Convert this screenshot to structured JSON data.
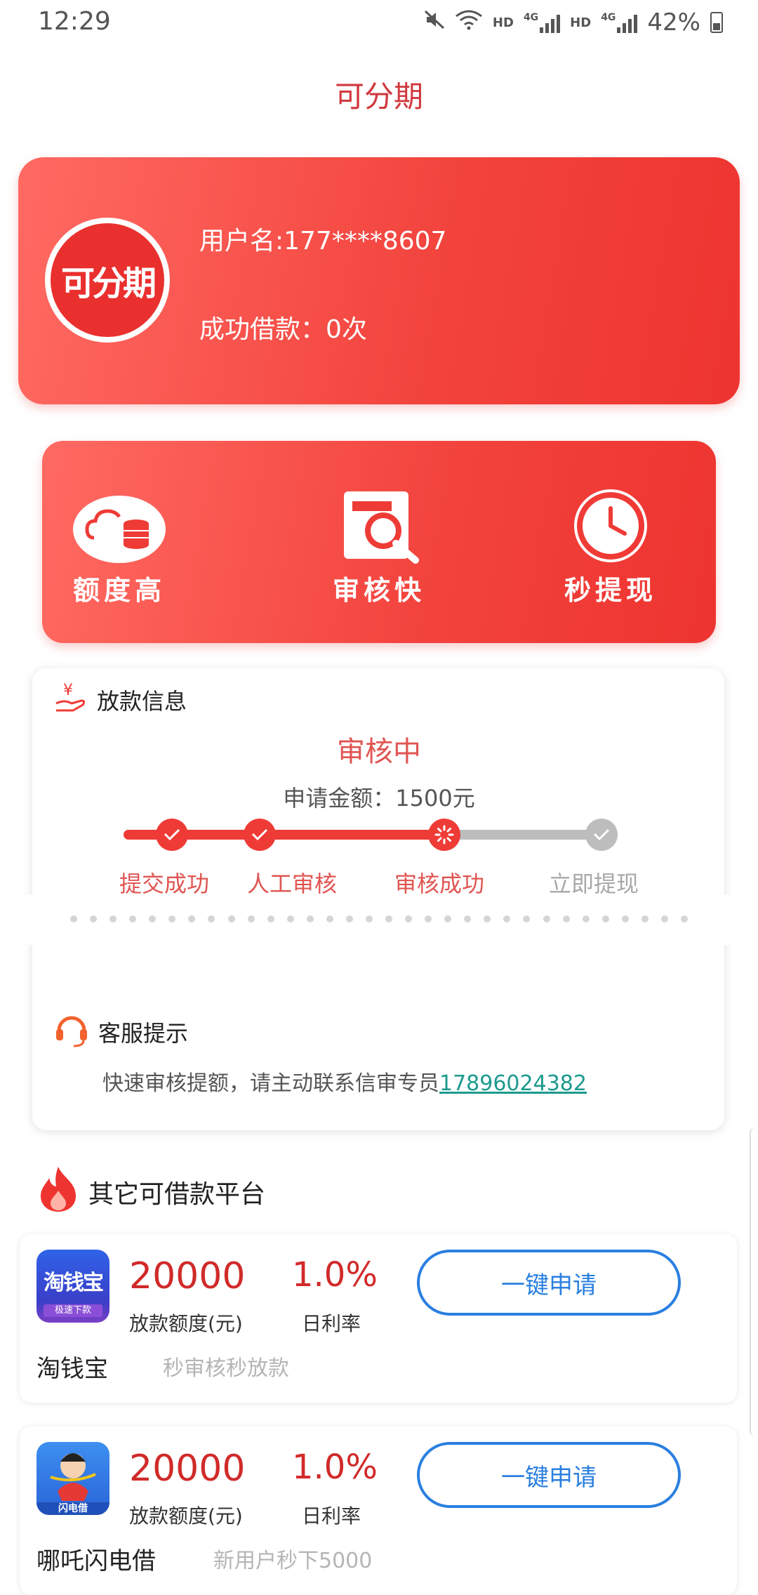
{
  "status_bar": {
    "time": "12:29",
    "battery": "42%",
    "hd1": "HD",
    "net1": "4G",
    "hd2": "HD",
    "net2": "4G"
  },
  "header": {
    "title": "可分期"
  },
  "user_card": {
    "avatar_text": "可分期",
    "username": "用户名:177****8607",
    "success_loans": "成功借款：0次"
  },
  "features": [
    {
      "label": "额度高",
      "icon": "cloud-coins-icon"
    },
    {
      "label": "审核快",
      "icon": "document-search-icon"
    },
    {
      "label": "秒提现",
      "icon": "clock-icon"
    }
  ],
  "loan_info": {
    "section_title": "放款信息",
    "status": "审核中",
    "amount": "申请金额：1500元",
    "steps": [
      {
        "label": "提交成功",
        "state": "done"
      },
      {
        "label": "人工审核",
        "state": "done"
      },
      {
        "label": "审核成功",
        "state": "current"
      },
      {
        "label": "立即提现",
        "state": "pending"
      }
    ]
  },
  "service": {
    "section_title": "客服提示",
    "tip_prefix": "快速审核提额，请主动联系信审专员",
    "phone": "17896024382"
  },
  "other": {
    "section_title": "其它可借款平台",
    "platforms": [
      {
        "logo_text": "淘钱宝",
        "logo_sub": "极速下款",
        "amount": "20000",
        "amount_label": "放款额度(元)",
        "rate": "1.0%",
        "rate_label": "日利率",
        "button": "一键申请",
        "name": "淘钱宝",
        "desc": "秒审核秒放款"
      },
      {
        "logo_text": "闪电借",
        "amount": "20000",
        "amount_label": "放款额度(元)",
        "rate": "1.0%",
        "rate_label": "日利率",
        "button": "一键申请",
        "name": "哪吒闪电借",
        "desc": "新用户秒下5000"
      }
    ]
  },
  "colors": {
    "brand_red": "#ef3b36",
    "title_red": "#d0383e",
    "link_teal": "#1c9a8d",
    "button_blue": "#2a7fe0"
  }
}
